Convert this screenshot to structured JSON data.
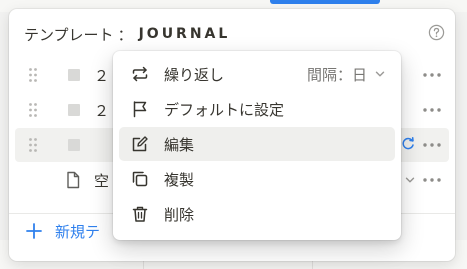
{
  "panel": {
    "header_label": "テンプレート",
    "header_separator": "：",
    "header_name": "JOURNAL"
  },
  "rows": [
    {
      "title": "２０"
    },
    {
      "title": "２０"
    },
    {
      "title": ""
    },
    {
      "title": "空白"
    }
  ],
  "new_button": {
    "label": "新規テ"
  },
  "menu": {
    "repeat_label": "繰り返し",
    "interval_label": "間隔：",
    "interval_value": "日",
    "set_default_label": "デフォルトに設定",
    "edit_label": "編集",
    "duplicate_label": "複製",
    "delete_label": "削除"
  },
  "colors": {
    "accent": "#2f80ed",
    "text": "#37352f",
    "muted": "#787774",
    "hover": "#efefed"
  },
  "icons": [
    "help-icon",
    "drag-handle-icon",
    "checkbox-icon",
    "more-icon",
    "sync-icon",
    "document-icon",
    "plus-icon",
    "repeat-icon",
    "flag-icon",
    "edit-icon",
    "duplicate-icon",
    "trash-icon",
    "chevron-down-icon"
  ]
}
